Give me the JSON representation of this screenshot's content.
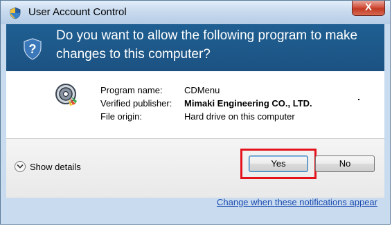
{
  "window": {
    "title": "User Account Control",
    "close_label": "X"
  },
  "banner": {
    "question": "Do you want to allow the following program to make changes to this computer?"
  },
  "program": {
    "name_label": "Program name:",
    "name_value": "CDMenu",
    "publisher_label": "Verified publisher:",
    "publisher_value": "Mimaki Engineering CO., LTD.",
    "origin_label": "File origin:",
    "origin_value": "Hard drive on this computer"
  },
  "footer": {
    "show_details": "Show details",
    "yes": "Yes",
    "no": "No",
    "change_link": "Change when these notifications appear"
  },
  "colors": {
    "banner": "#1f5f92",
    "highlight": "#e3131b",
    "link": "#1a4bb0"
  }
}
